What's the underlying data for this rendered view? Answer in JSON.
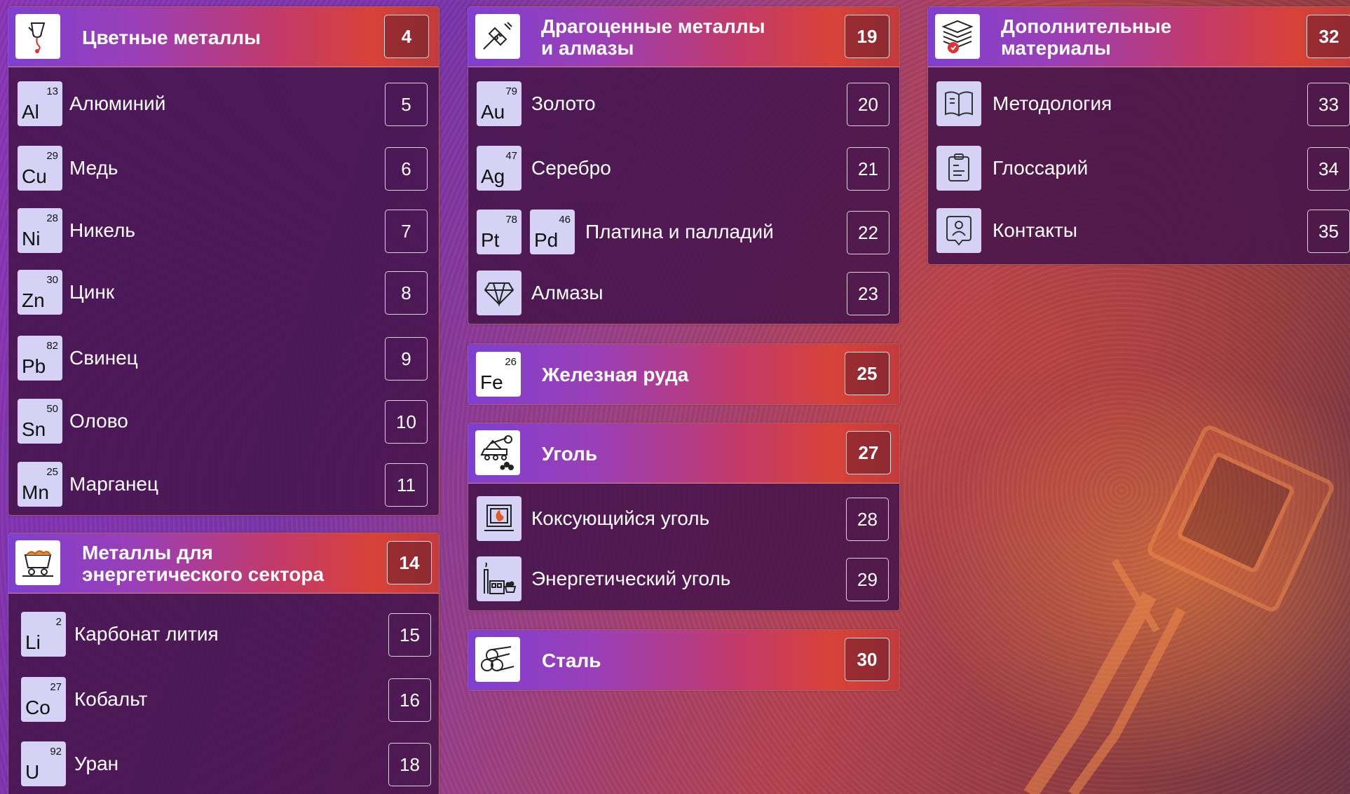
{
  "colors": {
    "panel_bg": "#46144b",
    "tile_bg": "#d6d2f5",
    "header_from": "#7e3fd0",
    "header_to": "#d84238"
  },
  "nonferrous": {
    "title": "Цветные металлы",
    "page": "4",
    "items": [
      {
        "an": "13",
        "sym": "Al",
        "label": "Алюминий",
        "page": "5"
      },
      {
        "an": "29",
        "sym": "Cu",
        "label": "Медь",
        "page": "6"
      },
      {
        "an": "28",
        "sym": "Ni",
        "label": "Никель",
        "page": "7"
      },
      {
        "an": "30",
        "sym": "Zn",
        "label": "Цинк",
        "page": "8"
      },
      {
        "an": "82",
        "sym": "Pb",
        "label": "Свинец",
        "page": "9"
      },
      {
        "an": "50",
        "sym": "Sn",
        "label": "Олово",
        "page": "10"
      },
      {
        "an": "25",
        "sym": "Mn",
        "label": "Марганец",
        "page": "11"
      }
    ]
  },
  "energy": {
    "title_line1": "Металлы для",
    "title_line2": "энергетического сектора",
    "page": "14",
    "items": [
      {
        "an": "2",
        "sym": "Li",
        "label": "Карбонат лития",
        "page": "15"
      },
      {
        "an": "27",
        "sym": "Co",
        "label": "Кобальт",
        "page": "16"
      },
      {
        "an": "92",
        "sym": "U",
        "label": "Уран",
        "page": "18"
      }
    ]
  },
  "precious": {
    "title_line1": "Драгоценные металлы",
    "title_line2": "и алмазы",
    "page": "19",
    "items": [
      {
        "an": "79",
        "sym": "Au",
        "label": "Золото",
        "page": "20"
      },
      {
        "an": "47",
        "sym": "Ag",
        "label": "Серебро",
        "page": "21"
      },
      {
        "an": "78",
        "sym": "Pt",
        "an2": "46",
        "sym2": "Pd",
        "label": "Платина и палладий",
        "page": "22"
      },
      {
        "icon": "diamond-icon",
        "label": "Алмазы",
        "page": "23"
      }
    ]
  },
  "iron": {
    "an": "26",
    "sym": "Fe",
    "title": "Железная руда",
    "page": "25"
  },
  "coal": {
    "title": "Уголь",
    "page": "27",
    "items": [
      {
        "icon": "coke-oven-icon",
        "label": "Коксующийся уголь",
        "page": "28"
      },
      {
        "icon": "power-plant-icon",
        "label": "Энергетический уголь",
        "page": "29"
      }
    ]
  },
  "steel": {
    "title": "Сталь",
    "page": "30"
  },
  "extra": {
    "title_line1": "Дополнительные",
    "title_line2": "материалы",
    "page": "32",
    "items": [
      {
        "icon": "book-icon",
        "label": "Методология",
        "page": "33"
      },
      {
        "icon": "clipboard-icon",
        "label": "Глоссарий",
        "page": "34"
      },
      {
        "icon": "contact-icon",
        "label": "Контакты",
        "page": "35"
      }
    ]
  }
}
